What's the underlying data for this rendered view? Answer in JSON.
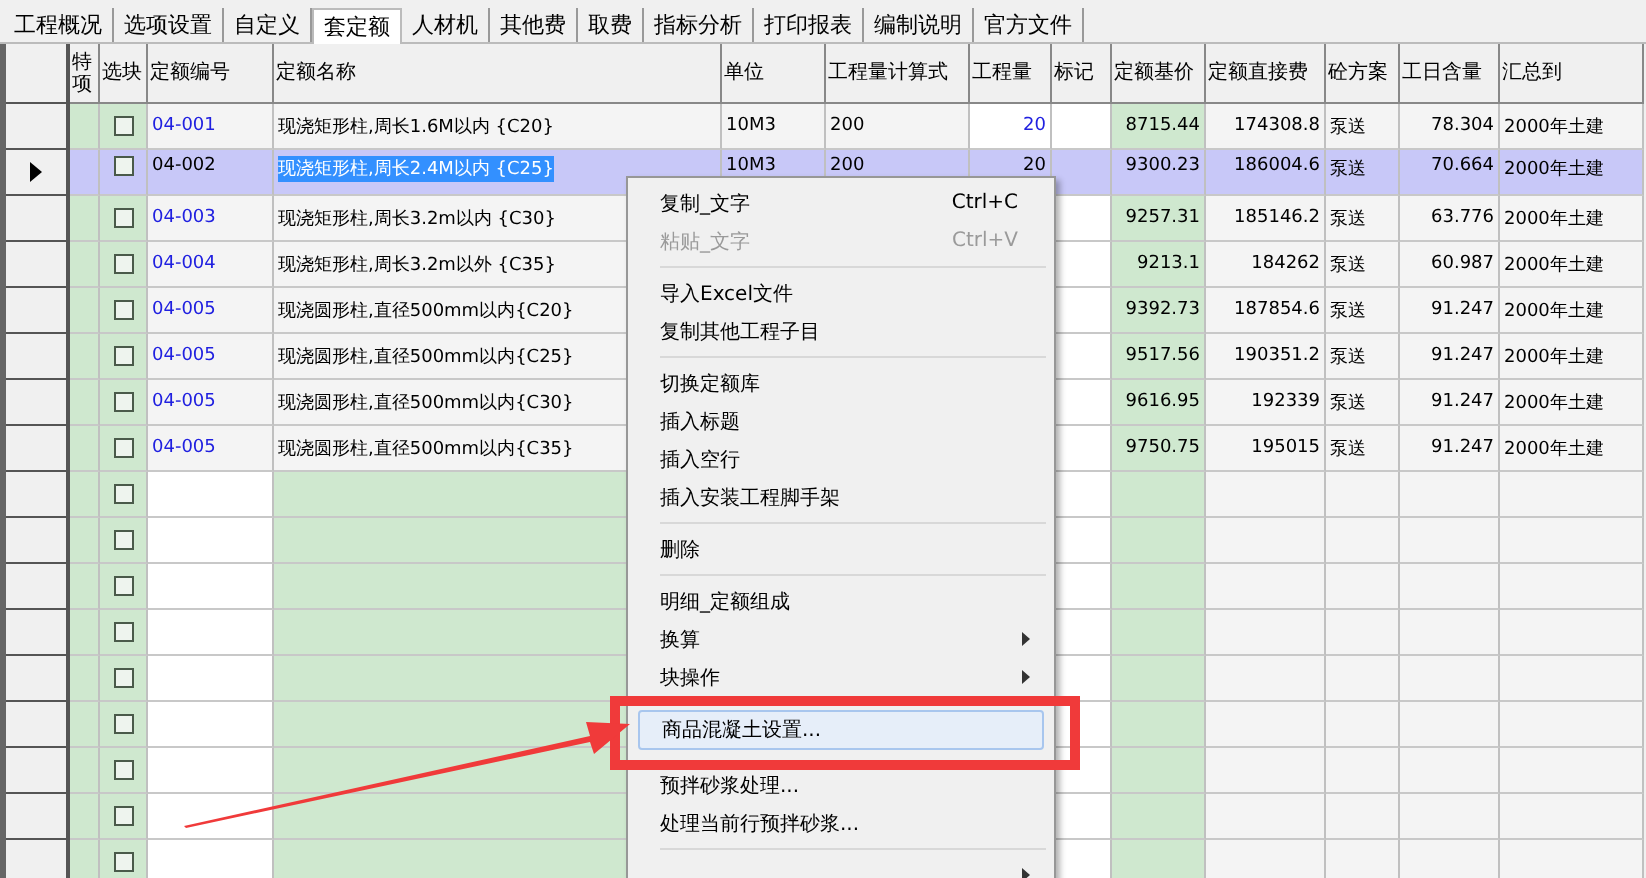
{
  "tabs": [
    {
      "label": "工程概况",
      "selected": false
    },
    {
      "label": "选项设置",
      "selected": false
    },
    {
      "label": "自定义",
      "selected": false
    },
    {
      "label": "套定额",
      "selected": true
    },
    {
      "label": "人材机",
      "selected": false
    },
    {
      "label": "其他费",
      "selected": false
    },
    {
      "label": "取费",
      "selected": false
    },
    {
      "label": "指标分析",
      "selected": false
    },
    {
      "label": "打印报表",
      "selected": false
    },
    {
      "label": "编制说明",
      "selected": false
    },
    {
      "label": "官方文件",
      "selected": false
    }
  ],
  "table": {
    "columns": [
      "特项",
      "选块",
      "定额编号",
      "定额名称",
      "单位",
      "工程量计算式",
      "工程量",
      "标记",
      "定额基价",
      "定额直接费",
      "砼方案",
      "工日含量",
      "汇总到"
    ],
    "rows": [
      {
        "selected": false,
        "checked": false,
        "code": "04-001",
        "name": "现浇矩形柱,周长1.6M以内 {C20}",
        "unit": "10M3",
        "formula": "200",
        "qty": "20",
        "qty_modified": true,
        "base_price": "8715.44",
        "direct_cost": "174308.8",
        "concrete_plan": "泵送",
        "labor": "78.304",
        "summary": "2000年土建"
      },
      {
        "selected": true,
        "checked": false,
        "code": "04-002",
        "name": "现浇矩形柱,周长2.4M以内 {C25}",
        "unit": "10M3",
        "formula": "200",
        "qty": "20",
        "qty_modified": false,
        "base_price": "9300.23",
        "direct_cost": "186004.6",
        "concrete_plan": "泵送",
        "labor": "70.664",
        "summary": "2000年土建"
      },
      {
        "selected": false,
        "checked": false,
        "code": "04-003",
        "name": "现浇矩形柱,周长3.2m以内 {C30}",
        "base_price": "9257.31",
        "direct_cost": "185146.2",
        "concrete_plan": "泵送",
        "labor": "63.776",
        "summary": "2000年土建"
      },
      {
        "selected": false,
        "checked": false,
        "code": "04-004",
        "name": "现浇矩形柱,周长3.2m以外 {C35}",
        "base_price": "9213.1",
        "direct_cost": "184262",
        "concrete_plan": "泵送",
        "labor": "60.987",
        "summary": "2000年土建"
      },
      {
        "selected": false,
        "checked": false,
        "code": "04-005",
        "name": "现浇圆形柱,直径500mm以内{C20}",
        "base_price": "9392.73",
        "direct_cost": "187854.6",
        "concrete_plan": "泵送",
        "labor": "91.247",
        "summary": "2000年土建"
      },
      {
        "selected": false,
        "checked": false,
        "code": "04-005",
        "name": "现浇圆形柱,直径500mm以内{C25}",
        "base_price": "9517.56",
        "direct_cost": "190351.2",
        "concrete_plan": "泵送",
        "labor": "91.247",
        "summary": "2000年土建"
      },
      {
        "selected": false,
        "checked": false,
        "code": "04-005",
        "name": "现浇圆形柱,直径500mm以内{C30}",
        "base_price": "9616.95",
        "direct_cost": "192339",
        "concrete_plan": "泵送",
        "labor": "91.247",
        "summary": "2000年土建"
      },
      {
        "selected": false,
        "checked": false,
        "code": "04-005",
        "name": "现浇圆形柱,直径500mm以内{C35}",
        "base_price": "9750.75",
        "direct_cost": "195015",
        "concrete_plan": "泵送",
        "labor": "91.247",
        "summary": "2000年土建"
      },
      {
        "selected": false,
        "checked": false
      },
      {
        "selected": false,
        "checked": false
      },
      {
        "selected": false,
        "checked": false
      },
      {
        "selected": false,
        "checked": false
      },
      {
        "selected": false,
        "checked": false
      },
      {
        "selected": false,
        "checked": false
      },
      {
        "selected": false,
        "checked": false
      },
      {
        "selected": false,
        "checked": false
      },
      {
        "selected": false,
        "checked": false
      }
    ]
  },
  "context_menu": {
    "items": [
      {
        "kind": "item",
        "label": "复制_文字",
        "shortcut": "Ctrl+C",
        "disabled": false,
        "selected": false
      },
      {
        "kind": "item",
        "label": "粘贴_文字",
        "shortcut": "Ctrl+V",
        "disabled": true,
        "selected": false
      },
      {
        "kind": "separator"
      },
      {
        "kind": "item",
        "label": "导入Excel文件",
        "disabled": false,
        "selected": false
      },
      {
        "kind": "item",
        "label": "复制其他工程子目",
        "disabled": false,
        "selected": false
      },
      {
        "kind": "separator"
      },
      {
        "kind": "item",
        "label": "切换定额库",
        "disabled": false,
        "selected": false
      },
      {
        "kind": "item",
        "label": "插入标题",
        "disabled": false,
        "selected": false
      },
      {
        "kind": "item",
        "label": "插入空行",
        "disabled": false,
        "selected": false
      },
      {
        "kind": "item",
        "label": "插入安装工程脚手架",
        "disabled": false,
        "selected": false
      },
      {
        "kind": "separator"
      },
      {
        "kind": "item",
        "label": "删除",
        "disabled": false,
        "selected": false
      },
      {
        "kind": "separator"
      },
      {
        "kind": "item",
        "label": "明细_定额组成",
        "disabled": false,
        "selected": false
      },
      {
        "kind": "item",
        "label": "换算",
        "submenu": true,
        "disabled": false,
        "selected": false
      },
      {
        "kind": "item",
        "label": "块操作",
        "submenu": true,
        "disabled": false,
        "selected": false
      },
      {
        "kind": "separator"
      },
      {
        "kind": "item",
        "label": "商品混凝土设置...",
        "disabled": false,
        "selected": true
      },
      {
        "kind": "item",
        "label": "预拌砂浆处理...",
        "disabled": false,
        "selected": false
      },
      {
        "kind": "item",
        "label": "处理当前行预拌砂浆...",
        "disabled": false,
        "selected": false
      },
      {
        "kind": "separator"
      },
      {
        "kind": "item",
        "submenu": true,
        "disabled": false,
        "selected": false
      }
    ]
  }
}
